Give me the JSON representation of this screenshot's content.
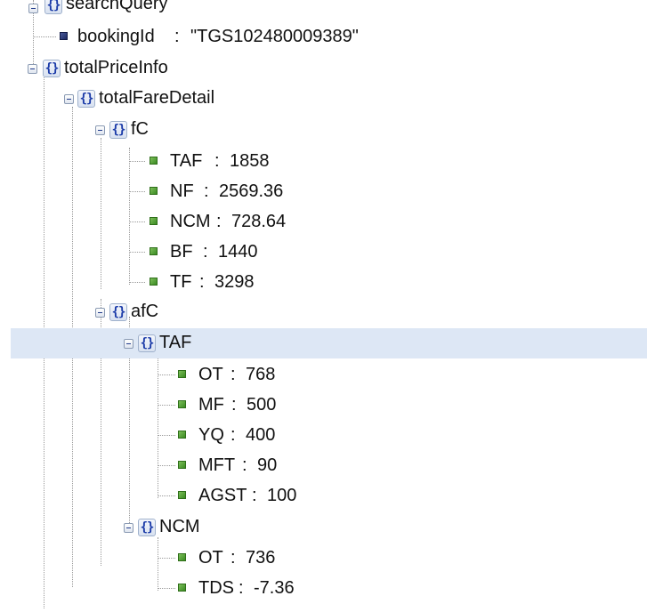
{
  "tree": {
    "root_label": "searchQuery",
    "booking": {
      "key": "bookingId",
      "value": "\"TGS102480009389\""
    },
    "totalPriceInfo": {
      "label": "totalPriceInfo",
      "totalFareDetail": {
        "label": "totalFareDetail",
        "fC": {
          "label": "fC",
          "items": [
            {
              "key": "TAF",
              "value": "1858"
            },
            {
              "key": "NF",
              "value": "2569.36"
            },
            {
              "key": "NCM",
              "value": "728.64"
            },
            {
              "key": "BF",
              "value": "1440"
            },
            {
              "key": "TF",
              "value": "3298"
            }
          ]
        },
        "afC": {
          "label": "afC",
          "TAF": {
            "label": "TAF",
            "items": [
              {
                "key": "OT",
                "value": "768"
              },
              {
                "key": "MF",
                "value": "500"
              },
              {
                "key": "YQ",
                "value": "400"
              },
              {
                "key": "MFT",
                "value": "90"
              },
              {
                "key": "AGST",
                "value": "100"
              }
            ]
          },
          "NCM": {
            "label": "NCM",
            "items": [
              {
                "key": "OT",
                "value": "736"
              },
              {
                "key": "TDS",
                "value": "-7.36"
              }
            ]
          }
        }
      }
    }
  },
  "colors": {
    "selection": "#dde7f5",
    "object_icon": "#1a3aa8",
    "leaf_number": "#3a8a22",
    "leaf_string": "#1d2a63"
  },
  "icons": {
    "object": "braces-icon",
    "number_leaf": "green-square-icon",
    "string_leaf": "navy-square-icon",
    "collapse": "collapse-minus-icon"
  }
}
